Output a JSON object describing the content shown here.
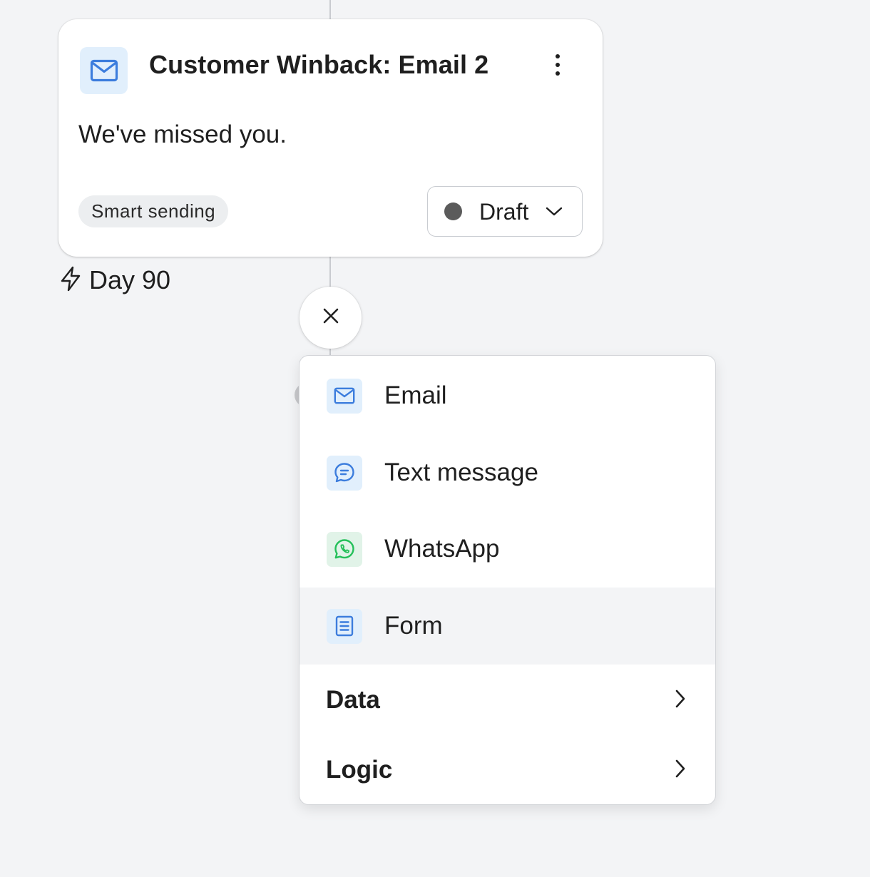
{
  "card": {
    "title": "Customer Winback: Email 2",
    "body": "We've missed you.",
    "badge": "Smart sending",
    "status": "Draft",
    "icon": "envelope-icon"
  },
  "trigger": {
    "label": "Day 90",
    "icon": "lightning-icon"
  },
  "menu": {
    "items": [
      {
        "label": "Email",
        "icon": "envelope-icon"
      },
      {
        "label": "Text message",
        "icon": "chat-bubble-icon"
      },
      {
        "label": "WhatsApp",
        "icon": "whatsapp-icon"
      },
      {
        "label": "Form",
        "icon": "form-document-icon",
        "highlighted": true
      }
    ],
    "groups": [
      {
        "label": "Data",
        "icon": "chevron-right-icon"
      },
      {
        "label": "Logic",
        "icon": "chevron-right-icon"
      }
    ]
  },
  "colors": {
    "accent": "#3c7ddd",
    "icon_bg": "#e1effc",
    "whatsapp": "#25c05a",
    "status_dot": "#5b5b5b",
    "canvas": "#f3f4f6"
  }
}
